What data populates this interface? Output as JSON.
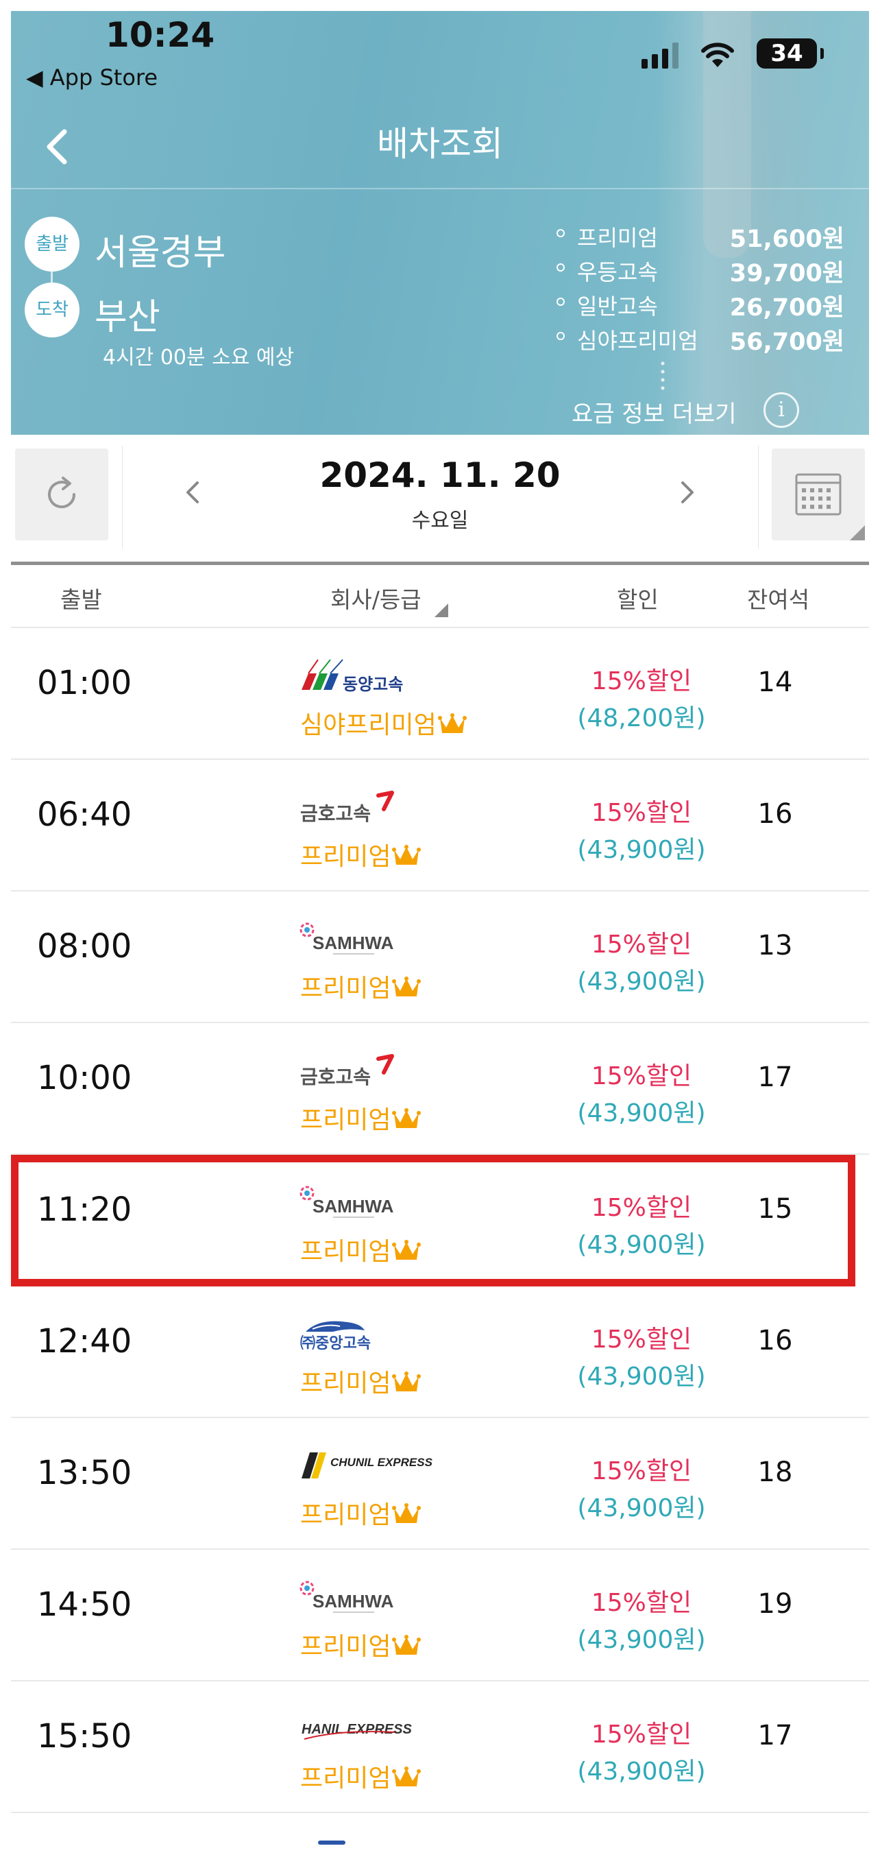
{
  "status_bar": {
    "time": "10:24",
    "back_app": "◀ App Store",
    "battery": "34"
  },
  "header": {
    "title": "배차조회",
    "departure_badge": "출발",
    "arrival_badge": "도착",
    "departure_city": "서울경부",
    "arrival_city": "부산",
    "duration": "4시간 00분 소요 예상",
    "fares": [
      {
        "name": "프리미엄",
        "price": "51,600원"
      },
      {
        "name": "우등고속",
        "price": "39,700원"
      },
      {
        "name": "일반고속",
        "price": "26,700원"
      },
      {
        "name": "심야프리미엄",
        "price": "56,700원"
      }
    ],
    "fare_more": "요금 정보 더보기",
    "info_icon": "i"
  },
  "datebar": {
    "date": "2024. 11. 20",
    "day": "수요일"
  },
  "columns": {
    "departure": "출발",
    "company": "회사/등급",
    "discount": "할인",
    "seats": "잔여석"
  },
  "rows": [
    {
      "time": "01:00",
      "company": "동양고속",
      "grade": "심야프리미엄",
      "discount": "15%할인",
      "price": "(48,200원)",
      "seats": "14"
    },
    {
      "time": "06:40",
      "company": "금호고속",
      "grade": "프리미엄",
      "discount": "15%할인",
      "price": "(43,900원)",
      "seats": "16"
    },
    {
      "time": "08:00",
      "company": "SAMHWA",
      "grade": "프리미엄",
      "discount": "15%할인",
      "price": "(43,900원)",
      "seats": "13"
    },
    {
      "time": "10:00",
      "company": "금호고속",
      "grade": "프리미엄",
      "discount": "15%할인",
      "price": "(43,900원)",
      "seats": "17"
    },
    {
      "time": "11:20",
      "company": "SAMHWA",
      "grade": "프리미엄",
      "discount": "15%할인",
      "price": "(43,900원)",
      "seats": "15"
    },
    {
      "time": "12:40",
      "company": "㈜중앙고속",
      "grade": "프리미엄",
      "discount": "15%할인",
      "price": "(43,900원)",
      "seats": "16"
    },
    {
      "time": "13:50",
      "company": "CHUNIL EXPRESS",
      "grade": "프리미엄",
      "discount": "15%할인",
      "price": "(43,900원)",
      "seats": "18"
    },
    {
      "time": "14:50",
      "company": "SAMHWA",
      "grade": "프리미엄",
      "discount": "15%할인",
      "price": "(43,900원)",
      "seats": "19"
    },
    {
      "time": "15:50",
      "company": "HANIL EXPRESS",
      "grade": "프리미엄",
      "discount": "15%할인",
      "price": "(43,900원)",
      "seats": "17"
    }
  ],
  "colors": {
    "accent": "#3ea3c0",
    "discount": "#e5305a",
    "price": "#2fa9b7",
    "grade": "#f5a100",
    "highlight": "#dc2020"
  }
}
